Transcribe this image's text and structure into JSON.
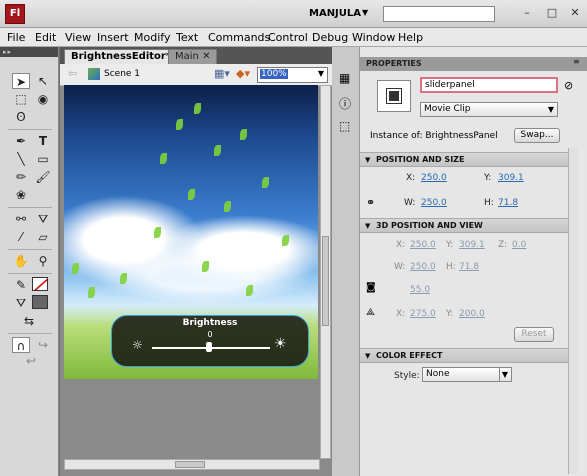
{
  "app": {
    "logo": "Fl",
    "workspace": "MANJULA",
    "search_value": ""
  },
  "menu": [
    "File",
    "Edit",
    "View",
    "Insert",
    "Modify",
    "Text",
    "Commands",
    "Control",
    "Debug",
    "Window",
    "Help"
  ],
  "tabs": [
    {
      "label": "BrightnessEditor*"
    },
    {
      "label": "Main"
    }
  ],
  "editbar": {
    "scene": "Scene 1",
    "zoom": "100%"
  },
  "panel": {
    "title": "Brightness",
    "value": "0"
  },
  "props": {
    "header": "PROPERTIES",
    "instance_name": "sliderpanel",
    "type": "Movie Clip",
    "instance_of": "Instance of:  BrightnessPanel",
    "swap": "Swap...",
    "sec_pos": "POSITION AND SIZE",
    "x_label": "X:",
    "x": "250.0",
    "y_label": "Y:",
    "y": "309.1",
    "w_label": "W:",
    "w": "250.0",
    "h_label": "H:",
    "h": "71.8",
    "sec_3d": "3D POSITION AND VIEW",
    "x3": "250.0",
    "y3": "309.1",
    "z_label": "Z:",
    "z3": "0.0",
    "w3": "250.0",
    "h3": "71.8",
    "persp": "55.0",
    "vx": "275.0",
    "vy": "200.0",
    "reset": "Reset",
    "sec_color": "COLOR EFFECT",
    "style_label": "Style:",
    "style": "None"
  },
  "colors": {
    "accent": "#3aa0d8",
    "brand": "#a3171c"
  }
}
